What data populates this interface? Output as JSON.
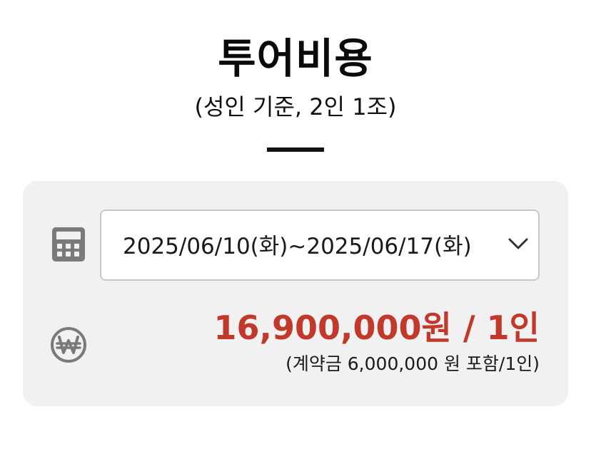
{
  "header": {
    "title": "투어비용",
    "subtitle": "(성인 기준, 2인 1조)"
  },
  "schedule": {
    "selected_date": "2025/06/10(화)~2025/06/17(화)",
    "icon": "calculator-icon"
  },
  "pricing": {
    "icon": "won-currency-icon",
    "price_text": "16,900,000원 / 1인",
    "deposit_note": "(계약금 6,000,000 원 포함/1인)"
  },
  "colors": {
    "accent_red": "#c0392b",
    "card_background": "#f1f1f1",
    "icon_gray": "#7a7a7a",
    "divider": "#111111"
  }
}
